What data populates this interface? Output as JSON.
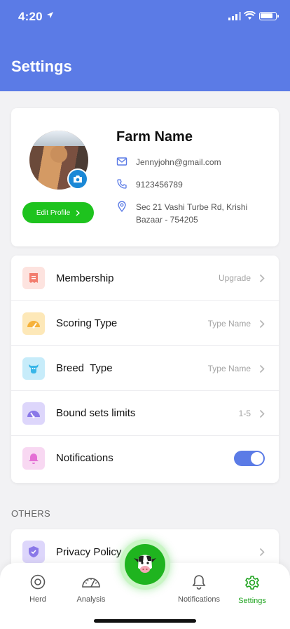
{
  "status_bar": {
    "time": "4:20"
  },
  "header": {
    "title": "Settings"
  },
  "profile": {
    "farm_name": "Farm Name",
    "email": "Jennyjohn@gmail.com",
    "phone": "9123456789",
    "address": "Sec 21 Vashi Turbe Rd, Krishi Bazaar - 754205",
    "edit_label": "Edit Profile"
  },
  "settings": {
    "items": [
      {
        "label": "Membership",
        "value": "Upgrade",
        "icon": "receipt-icon",
        "color": "#f27d6e",
        "bg": "#fde3df"
      },
      {
        "label": "Scoring Type",
        "value": "Type Name",
        "icon": "gauge-icon",
        "color": "#f6b23b",
        "bg": "#fde8b8"
      },
      {
        "label": "Breed  Type",
        "value": "Type Name",
        "icon": "cattle-icon",
        "color": "#38b6e8",
        "bg": "#c7ecfa"
      },
      {
        "label": "Bound sets limits",
        "value": "1-5",
        "icon": "speed-icon",
        "color": "#8a78e8",
        "bg": "#ddd6fb"
      },
      {
        "label": "Notifications",
        "value": "",
        "icon": "bell-icon",
        "color": "#e46fd5",
        "bg": "#f8d8f2",
        "toggle": true
      }
    ]
  },
  "others": {
    "section_label": "OTHERS",
    "items": [
      {
        "label": "Privacy Policy",
        "icon": "shield-check-icon",
        "color": "#8a78e8",
        "bg": "#ddd6fb"
      }
    ]
  },
  "tabbar": {
    "tabs": [
      {
        "label": "Herd",
        "icon": "eye-icon"
      },
      {
        "label": "Analysis",
        "icon": "speedometer-icon"
      },
      {
        "label": "Notifications",
        "icon": "bell-icon"
      },
      {
        "label": "Settings",
        "icon": "gear-icon",
        "active": true
      }
    ],
    "center_icon": "cow-icon",
    "active_color": "#1ea31e"
  }
}
